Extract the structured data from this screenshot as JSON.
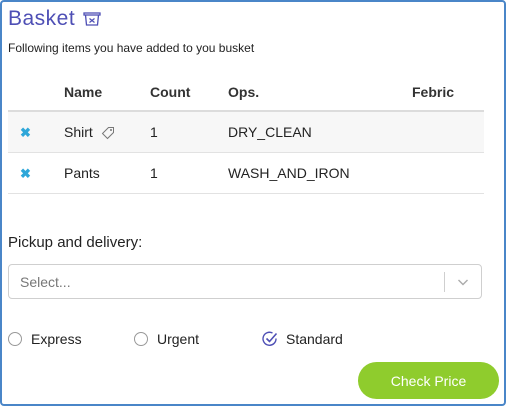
{
  "header": {
    "title": "Basket",
    "subtitle": "Following items you have added to you busket"
  },
  "table": {
    "columns": [
      "",
      "Name",
      "Count",
      "Ops.",
      "Febric"
    ],
    "rows": [
      {
        "name": "Shirt",
        "count": "1",
        "ops": "DRY_CLEAN",
        "fabric": ""
      },
      {
        "name": "Pants",
        "count": "1",
        "ops": "WASH_AND_IRON",
        "fabric": ""
      }
    ]
  },
  "pickup": {
    "label": "Pickup and delivery:",
    "placeholder": "Select..."
  },
  "delivery_options": [
    {
      "label": "Express",
      "selected": false
    },
    {
      "label": "Urgent",
      "selected": false
    },
    {
      "label": "Standard",
      "selected": true
    }
  ],
  "actions": {
    "check_price": "Check Price"
  },
  "colors": {
    "title": "#4e4fb5",
    "accent_blue": "#2fa7d9",
    "button_green": "#8fcc2d",
    "frame_border": "#4a86c8"
  },
  "icons": {
    "basket": "basket-icon",
    "remove": "remove-x-icon",
    "tag": "tag-icon",
    "chevron": "chevron-down-icon",
    "checked": "check-circle-icon"
  }
}
